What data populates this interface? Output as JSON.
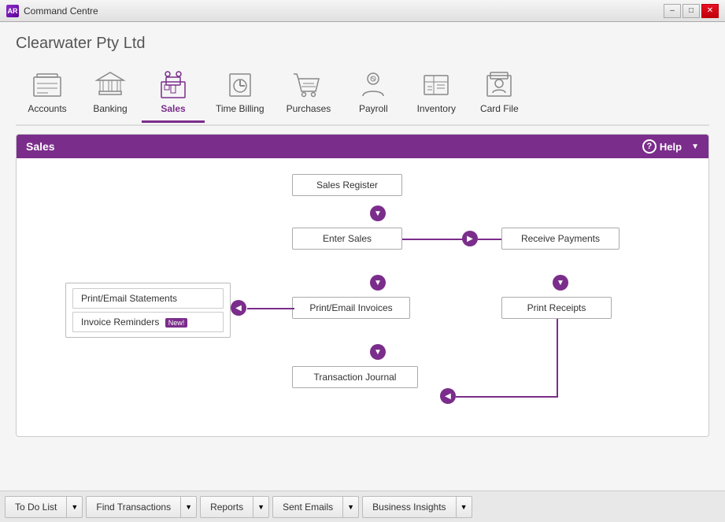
{
  "titleBar": {
    "appIcon": "AR",
    "title": "Command Centre",
    "controls": [
      "minimize",
      "maximize",
      "close"
    ]
  },
  "companyName": "Clearwater Pty Ltd",
  "nav": {
    "items": [
      {
        "id": "accounts",
        "label": "Accounts",
        "active": false
      },
      {
        "id": "banking",
        "label": "Banking",
        "active": false
      },
      {
        "id": "sales",
        "label": "Sales",
        "active": true
      },
      {
        "id": "timebilling",
        "label": "Time Billing",
        "active": false
      },
      {
        "id": "purchases",
        "label": "Purchases",
        "active": false
      },
      {
        "id": "payroll",
        "label": "Payroll",
        "active": false
      },
      {
        "id": "inventory",
        "label": "Inventory",
        "active": false
      },
      {
        "id": "cardfile",
        "label": "Card File",
        "active": false
      }
    ]
  },
  "salesPanel": {
    "title": "Sales",
    "helpLabel": "Help",
    "flowItems": {
      "salesRegister": "Sales Register",
      "enterSales": "Enter Sales",
      "receivePayments": "Receive Payments",
      "printEmailInvoices": "Print/Email Invoices",
      "printReceipts": "Print Receipts",
      "transactionJournal": "Transaction Journal",
      "printEmailStatements": "Print/Email Statements",
      "invoiceReminders": "Invoice Reminders",
      "newBadge": "New!"
    }
  },
  "bottomBar": {
    "items": [
      {
        "id": "todo",
        "label": "To Do List"
      },
      {
        "id": "findtransactions",
        "label": "Find Transactions"
      },
      {
        "id": "reports",
        "label": "Reports"
      },
      {
        "id": "sentemails",
        "label": "Sent Emails"
      },
      {
        "id": "businessinsights",
        "label": "Business Insights"
      }
    ]
  }
}
